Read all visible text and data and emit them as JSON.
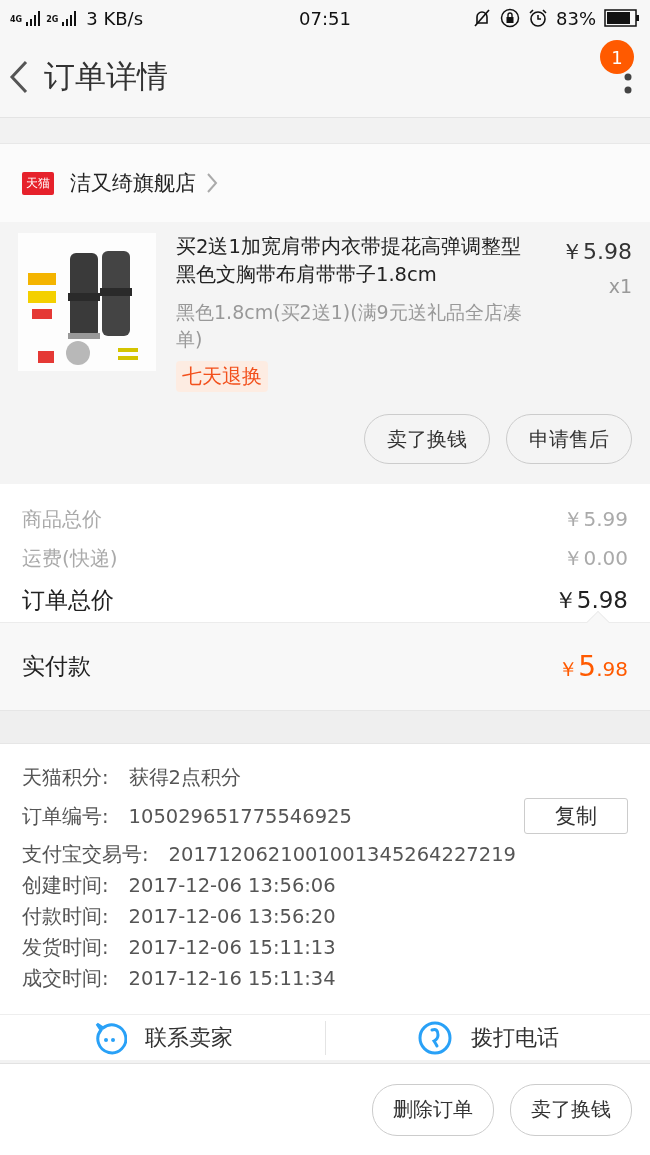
{
  "status_bar": {
    "network_1": "4G",
    "network_2": "2G",
    "speed": "3 KB/s",
    "time": "07:51",
    "battery": "83%"
  },
  "header": {
    "title": "订单详情",
    "badge": "1"
  },
  "store": {
    "tag": "天猫",
    "name": "洁又绮旗舰店"
  },
  "product": {
    "kind": "picture",
    "title": "买2送1加宽肩带内衣带提花高弹调整型黑色文胸带布肩带带子1.8cm",
    "price": "￥5.98",
    "quantity": "x1",
    "variant": "黑色1.8cm(买2送1)(满9元送礼品全店凑单)",
    "tag": "七天退换",
    "actions": [
      "卖了换钱",
      "申请售后"
    ]
  },
  "summary": [
    {
      "kind": "minor",
      "label": "商品总价",
      "value": "￥5.99"
    },
    {
      "kind": "minor",
      "label": "运费(快递)",
      "value": "￥0.00"
    },
    {
      "kind": "major",
      "label": "订单总价",
      "value": "￥5.98"
    }
  ],
  "paid": {
    "label": "实付款",
    "currency": "￥",
    "integer": "5",
    "decimal": ".98"
  },
  "info": [
    {
      "label": "天猫积分:",
      "value": "获得2点积分"
    },
    {
      "label": "订单编号:",
      "value": "105029651775546925",
      "action": "复制"
    },
    {
      "label": "支付宝交易号:",
      "value": "2017120621001001345264227219"
    },
    {
      "label": "创建时间:",
      "value": "2017-12-06 13:56:06"
    },
    {
      "label": "付款时间:",
      "value": "2017-12-06 13:56:20"
    },
    {
      "label": "发货时间:",
      "value": "2017-12-06 15:11:13"
    },
    {
      "label": "成交时间:",
      "value": "2017-12-16 15:11:34"
    }
  ],
  "contact": [
    {
      "kind": "chat",
      "label": "联系卖家"
    },
    {
      "kind": "phone",
      "label": "拨打电话"
    }
  ],
  "bottom_actions": [
    "删除订单",
    "卖了换钱"
  ]
}
